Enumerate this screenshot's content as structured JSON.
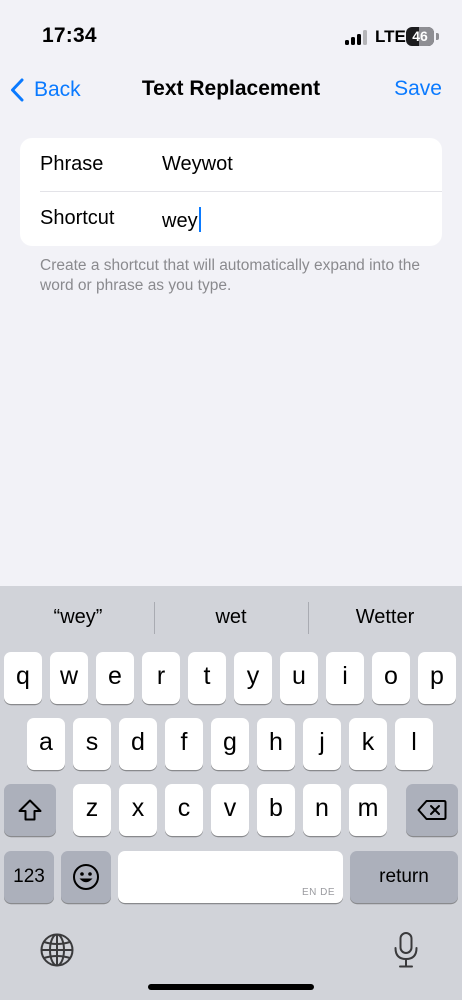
{
  "status_bar": {
    "time": "17:34",
    "network": "LTE",
    "battery": "46",
    "battery_level_percent": 46,
    "signal_bars_active": 3,
    "signal_bars_total": 4
  },
  "nav": {
    "back_label": "Back",
    "title": "Text Replacement",
    "save_label": "Save",
    "accent_color": "#0a7aff"
  },
  "form": {
    "phrase_label": "Phrase",
    "phrase_value": "Weywot",
    "shortcut_label": "Shortcut",
    "shortcut_value": "wey",
    "note": "Create a shortcut that will automatically expand into the word or phrase as you type."
  },
  "keyboard": {
    "suggestions": [
      "“wey”",
      "wet",
      "Wetter"
    ],
    "row1": [
      "q",
      "w",
      "e",
      "r",
      "t",
      "y",
      "u",
      "i",
      "o",
      "p"
    ],
    "row2": [
      "a",
      "s",
      "d",
      "f",
      "g",
      "h",
      "j",
      "k",
      "l"
    ],
    "row3": [
      "z",
      "x",
      "c",
      "v",
      "b",
      "n",
      "m"
    ],
    "numbers_label": "123",
    "space_languages": "EN DE",
    "return_label": "return",
    "icons": {
      "shift": "shift-icon",
      "delete": "backspace-icon",
      "emoji": "emoji-icon",
      "globe": "globe-icon",
      "dictation": "microphone-icon"
    }
  }
}
